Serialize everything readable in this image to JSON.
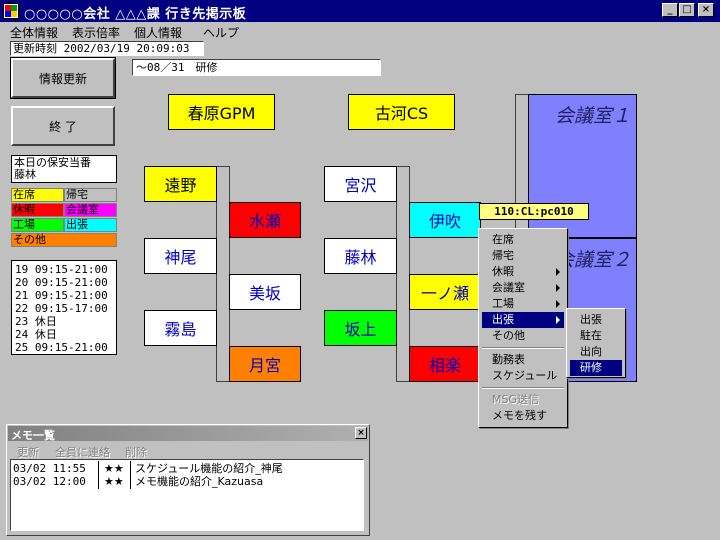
{
  "window": {
    "title": "○○○○○会社 △△△課 行き先掲示板",
    "minimize": "_",
    "maximize": "□",
    "close": "×"
  },
  "menu": [
    "全体情報",
    "表示倍率",
    "個人情報",
    "ヘルプ"
  ],
  "update_time": "更新時刻 2002/03/19 20:09:03",
  "buttons": {
    "refresh": "情報更新",
    "exit": "終 了"
  },
  "status_field": "～08／31　研修",
  "duty": {
    "title": "本日の保安当番",
    "name": "藤林"
  },
  "legend": [
    {
      "label": "在席",
      "color": "#ffff00"
    },
    {
      "label": "帰宅",
      "color": "#c0c0c0"
    },
    {
      "label": "休暇",
      "color": "#ff0000"
    },
    {
      "label": "会議室",
      "color": "#ff00ff"
    },
    {
      "label": "工場",
      "color": "#00ff00"
    },
    {
      "label": "出張",
      "color": "#00ffff"
    },
    {
      "label": "その他",
      "color": "#ff8000"
    }
  ],
  "schedule": [
    "19 09:15-21:00",
    "20 09:15-21:00",
    "21 09:15-21:00",
    "22 09:15-17:00",
    "23 休日",
    "24 休日",
    "25 09:15-21:00"
  ],
  "board": {
    "top_left": "春原GPM",
    "top_right": "古河CS",
    "col1_left": [
      "遠野",
      "神尾",
      "霧島"
    ],
    "col1_right": [
      "水瀬",
      "美坂",
      "月宮"
    ],
    "col2_left": [
      "宮沢",
      "藤林",
      "坂上"
    ],
    "col2_right": [
      "伊吹",
      "一ノ瀬",
      "相楽"
    ],
    "rooms": [
      "会議室１",
      "会議室２"
    ]
  },
  "tooltip": "110:CL:pc010",
  "context_menu": {
    "items": [
      "在席",
      "帰宅",
      "休暇",
      "会議室",
      "工場",
      "出張",
      "その他",
      "勤務表",
      "スケジュール",
      "MSG送信",
      "メモを残す"
    ],
    "submenu": [
      "出張",
      "駐在",
      "出向",
      "研修"
    ]
  },
  "memo": {
    "title": "メモ一覧",
    "close": "×",
    "toolbar": [
      "更新",
      "全員に連絡",
      "削除"
    ],
    "rows": [
      {
        "time": "03/02 11:55",
        "mark": "★★",
        "text": "スケジュール機能の紹介_神尾"
      },
      {
        "time": "03/02 12:00",
        "mark": "★★",
        "text": "メモ機能の紹介_Kazuasa"
      }
    ]
  }
}
